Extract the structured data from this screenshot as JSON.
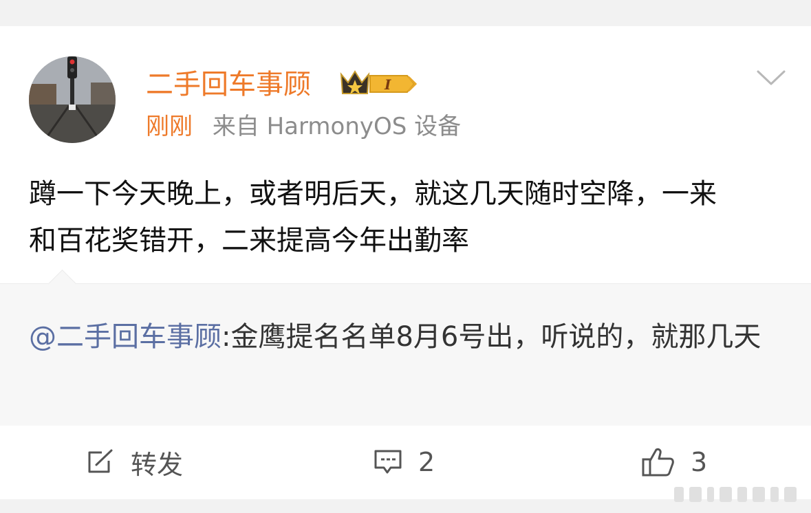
{
  "post": {
    "username": "二手回车事顾",
    "badge_level": "I",
    "time": "刚刚",
    "source": "来自 HarmonyOS 设备",
    "content": "蹲一下今天晚上，或者明后天，就这几天随时空降，一来和百花奖错开，二来提高今年出勤率"
  },
  "quote": {
    "mention": "@二手回车事顾",
    "text": ":金鹰提名名单8月6号出，听说的，就那几天"
  },
  "actions": {
    "repost_label": "转发",
    "comment_count": "2",
    "like_count": "3"
  },
  "icons": {
    "avatar": "railway-signal-photo",
    "badge": "crown-badge-icon",
    "more": "chevron-down-icon",
    "repost": "share-edit-icon",
    "comment": "comment-bubble-icon",
    "like": "thumbs-up-icon"
  },
  "colors": {
    "username": "#ee7a2a",
    "mention": "#5b6fa3",
    "quote_bg": "#f7f7f7"
  }
}
